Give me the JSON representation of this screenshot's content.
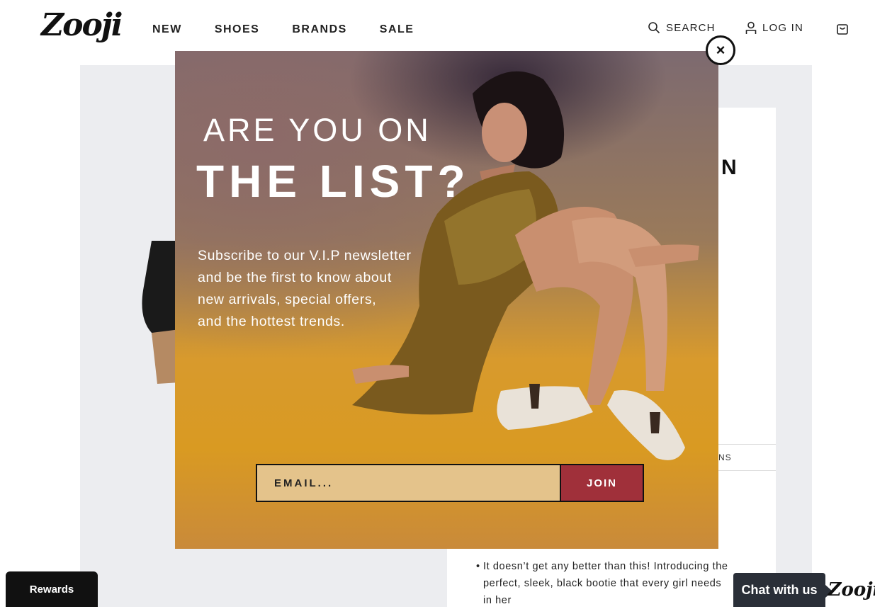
{
  "header": {
    "logo": "Zooji",
    "nav": [
      "NEW",
      "SHOES",
      "BRANDS",
      "SALE"
    ],
    "search_label": "SEARCH",
    "login_label": "LOG IN"
  },
  "background_page": {
    "title_fragment": "N",
    "tab_fragment": "NS",
    "description": "It doesn’t get any better than this! Introducing the perfect, sleek, black bootie that every girl needs in her"
  },
  "modal": {
    "headline_line1": "ARE YOU ON",
    "headline_line2": "THE LIST?",
    "subtext_lines": [
      "Subscribe to our V.I.P newsletter",
      "and be the first to know about",
      "new arrivals, special offers,",
      "and the hottest trends."
    ],
    "email_placeholder": "EMAIL...",
    "join_label": "JOIN",
    "close_symbol": "×"
  },
  "widgets": {
    "rewards_label": "Rewards",
    "chat_label": "Chat with us",
    "chat_logo": "Zooji"
  },
  "colors": {
    "join_button": "#a0303a",
    "email_field": "#e4c38b",
    "chat_bg": "#2a2f38"
  }
}
